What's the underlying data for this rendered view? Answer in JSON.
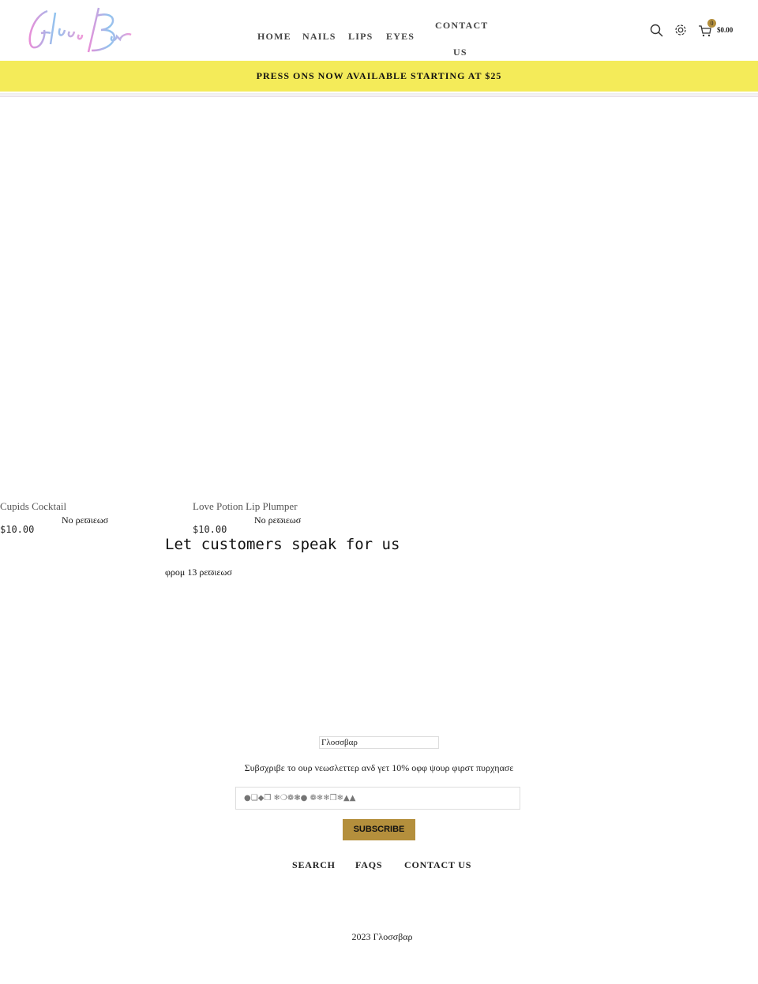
{
  "header": {
    "logo_text": "Gloss Bar",
    "nav": [
      "HOME",
      "NAILS",
      "LIPS",
      "EYES",
      "CONTACT",
      "US"
    ],
    "cart_count": "0",
    "cart_total": "$0.00"
  },
  "promo": {
    "text": "PRESS ONS NOW AVAILABLE STARTING AT $25"
  },
  "products": [
    {
      "title": "Cupids Cocktail",
      "reviews": "Νο ρεϖιεωσ",
      "price": "$10.00"
    },
    {
      "title": "Love Potion Lip Plumper",
      "reviews": "Νο ρεϖιεωσ",
      "price": "$10.00"
    }
  ],
  "testimonials": {
    "heading": "Let customers speak for us",
    "count_text": "φρομ 13 ρεϖιεωσ"
  },
  "newsletter": {
    "brand": "Γλοσσβαρ",
    "text": "Συβσχριβε το ουρ νεωσλεττερ ανδ γετ 10% οφφ ψουρ φιρστ πυρχηασε",
    "placeholder": "●❏◆❒ ❄❍❁❃● ❁❄❄❒❄▲▲",
    "button": "SUBSCRIBE"
  },
  "footer": {
    "links": [
      "SEARCH",
      "FAQS",
      "CONTACT US"
    ],
    "copyright": "2023 Γλοσσβαρ"
  },
  "colors": {
    "promo_bg": "#f4eb59",
    "button_bg": "#b48f3c",
    "badge": "#b48f3c"
  }
}
